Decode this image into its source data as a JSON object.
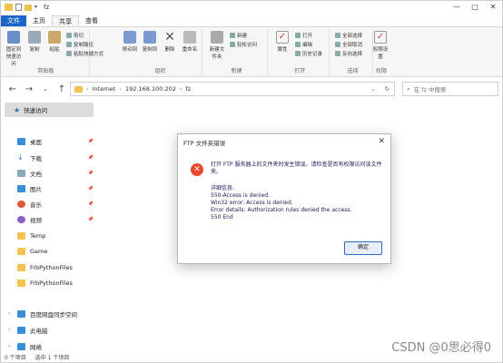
{
  "window": {
    "title": "fz",
    "controls": [
      "—",
      "□",
      "✕"
    ]
  },
  "ribbon_tabs": [
    "文件",
    "主页",
    "共享",
    "查看"
  ],
  "ribbon": {
    "clipboard": {
      "label": "剪贴板",
      "pin": "固定到快速访问",
      "copy": "复制",
      "paste": "粘贴",
      "cut": "剪切",
      "copy_path": "复制路径",
      "paste_shortcut": "粘贴快捷方式"
    },
    "organize": {
      "label": "组织",
      "move": "移动到",
      "copy_to": "复制到",
      "delete": "删除",
      "rename": "重命名"
    },
    "new": {
      "label": "新建",
      "new_folder": "新建文件夹",
      "new_item": "新建",
      "easy_access": "轻松访问"
    },
    "open": {
      "label": "打开",
      "properties": "属性",
      "open": "打开",
      "edit": "编辑",
      "history": "历史记录"
    },
    "select": {
      "label": "选择",
      "select_all": "全部选择",
      "select_none": "全部取消",
      "invert": "反向选择"
    },
    "rights": {
      "label": "权限",
      "rights_btn": "权限设置"
    }
  },
  "address": {
    "crumbs": [
      "Internet",
      "192.168.100.202",
      "fz"
    ],
    "search_placeholder": "在 fz 中搜索"
  },
  "sidebar": {
    "quick_access": "快速访问",
    "items": [
      {
        "label": "桌面",
        "pinned": true
      },
      {
        "label": "下载",
        "pinned": true
      },
      {
        "label": "文档",
        "pinned": true
      },
      {
        "label": "图片",
        "pinned": true
      },
      {
        "label": "音乐",
        "pinned": true
      },
      {
        "label": "视频",
        "pinned": true
      },
      {
        "label": "Temp",
        "pinned": false
      },
      {
        "label": "Game",
        "pinned": false
      },
      {
        "label": "FrbPythonFiles",
        "pinned": false
      },
      {
        "label": "FrbPythonFiles",
        "pinned": false
      }
    ],
    "bottom": [
      "百度网盘同步空间",
      "此电脑",
      "网络"
    ]
  },
  "status": {
    "count": "0 个项目",
    "selected": "选中 1 个项目"
  },
  "dialog": {
    "title": "FTP 文件夹错误",
    "close": "✕",
    "message": "打开 FTP 服务器上的文件夹时发生错误。请检查是否有权限访问该文件夹。",
    "detail_header": "详细信息:",
    "details": [
      "550-Access is denied.",
      "Win32 error:   Access is denied.",
      "Error details: Authorization rules denied the access.",
      "550 End"
    ],
    "ok": "确定"
  },
  "watermark": "CSDN @0思必得0",
  "colors": {
    "accent": "#1a66c8",
    "error": "#e8482b",
    "folder": "#f3c350"
  }
}
